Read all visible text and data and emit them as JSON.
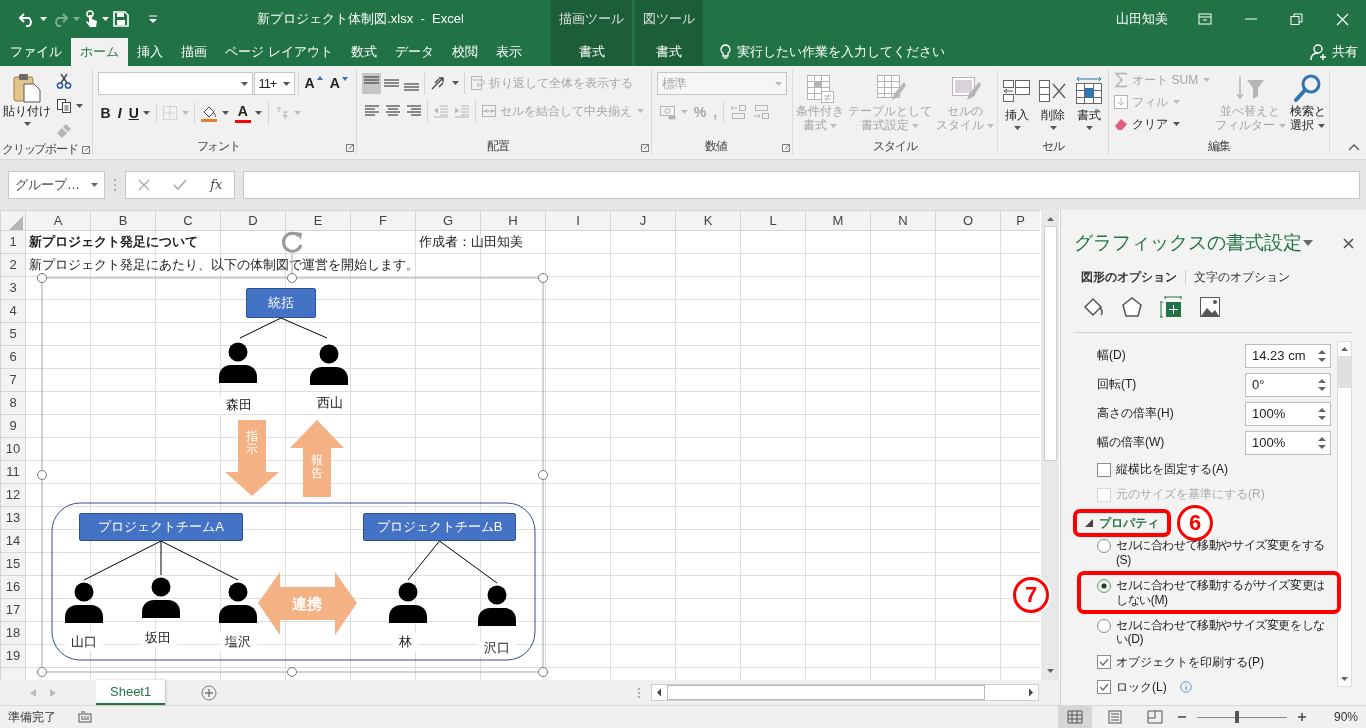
{
  "title_bar": {
    "title": "新プロジェクト体制図.xlsx  -  Excel",
    "user": "山田知美"
  },
  "tabs": [
    {
      "label": "ファイル",
      "selected": false
    },
    {
      "label": "ホーム",
      "selected": true
    },
    {
      "label": "挿入",
      "selected": false
    },
    {
      "label": "描画",
      "selected": false
    },
    {
      "label": "ページ レイアウト",
      "selected": false
    },
    {
      "label": "数式",
      "selected": false
    },
    {
      "label": "データ",
      "selected": false
    },
    {
      "label": "校閲",
      "selected": false
    },
    {
      "label": "表示",
      "selected": false
    }
  ],
  "tool_groups": [
    {
      "label": "描画ツール",
      "tabs": [
        {
          "label": "書式",
          "selected": false
        }
      ]
    },
    {
      "label": "図ツール",
      "tabs": [
        {
          "label": "書式",
          "selected": false
        }
      ]
    }
  ],
  "tell_me": {
    "placeholder": "実行したい作業を入力してください"
  },
  "share": "共有",
  "ribbon": [
    {
      "label": "クリップボード",
      "launcher": true,
      "lines": [
        [
          {
            "kind": "paste",
            "label": [
              "貼り付け"
            ],
            "menu": true,
            "disabled": false
          }
        ],
        [
          {
            "kind": "cut",
            "menu": false,
            "disabled": false
          },
          {
            "kind": "copy",
            "menu": true,
            "disabled": false
          },
          {
            "kind": "brush",
            "menu": false,
            "disabled": true
          }
        ]
      ]
    },
    {
      "label": "フォント",
      "launcher": true,
      "lines": [
        [
          [
            {
              "kind": "font-name",
              "menu": true,
              "disabled": false
            },
            {
              "kind": "font-size",
              "value": "11+",
              "menu": true,
              "disabled": false
            }
          ],
          [
            {
              "kind": "grow",
              "label": "A",
              "menu": false,
              "disabled": false
            },
            {
              "kind": "shrink",
              "label": "A",
              "menu": false,
              "disabled": false
            }
          ]
        ],
        [
          [
            {
              "kind": "bold",
              "label": "B",
              "menu": false,
              "disabled": false
            },
            {
              "kind": "italic",
              "label": "I",
              "menu": false,
              "disabled": false
            },
            {
              "kind": "underline",
              "label": "U",
              "menu": true,
              "disabled": false
            }
          ],
          [
            {
              "kind": "border",
              "menu": true,
              "disabled": true
            }
          ],
          [
            {
              "kind": "fill",
              "menu": true,
              "disabled": false
            },
            {
              "kind": "fontcolor",
              "label": "A",
              "menu": true,
              "disabled": false
            }
          ],
          [
            {
              "kind": "phonetic",
              "menu": true,
              "disabled": true
            }
          ]
        ]
      ]
    },
    {
      "label": "配置",
      "launcher": true,
      "lines": [
        [
          [
            {
              "kind": "align-top",
              "selected": true,
              "menu": false,
              "disabled": false
            },
            {
              "kind": "align-middle",
              "selected": false,
              "menu": false,
              "disabled": false
            },
            {
              "kind": "align-bottom",
              "selected": false,
              "menu": false,
              "disabled": false
            }
          ],
          [
            {
              "kind": "orient",
              "menu": true,
              "disabled": false
            }
          ],
          [
            {
              "kind": "wrap",
              "label": "折り返して全体を表示する",
              "menu": false,
              "disabled": true
            }
          ]
        ],
        [
          [
            {
              "kind": "align-left",
              "selected": false,
              "menu": false,
              "disabled": false
            },
            {
              "kind": "align-center",
              "selected": false,
              "menu": false,
              "disabled": false
            },
            {
              "kind": "align-right",
              "selected": false,
              "menu": false,
              "disabled": false
            }
          ],
          [
            {
              "kind": "indent-dec",
              "menu": false,
              "disabled": true
            },
            {
              "kind": "indent-inc",
              "menu": false,
              "disabled": true
            }
          ],
          [
            {
              "kind": "merge",
              "label": "セルを結合して中央揃え",
              "menu": true,
              "disabled": true
            }
          ]
        ]
      ]
    },
    {
      "label": "数値",
      "launcher": true,
      "lines": [
        [
          [
            {
              "kind": "number-format",
              "value": "標準",
              "menu": true,
              "disabled": true
            }
          ]
        ],
        [
          [
            {
              "kind": "currency",
              "menu": true,
              "disabled": true
            },
            {
              "kind": "percent",
              "label": "%",
              "menu": false,
              "disabled": true
            },
            {
              "kind": "comma",
              "label": ",",
              "menu": false,
              "disabled": true
            }
          ],
          [
            {
              "kind": "dec-inc",
              "menu": false,
              "disabled": true
            },
            {
              "kind": "dec-dec",
              "menu": false,
              "disabled": true
            }
          ]
        ]
      ]
    },
    {
      "label": "スタイル",
      "launcher": false,
      "lines": [
        [
          {
            "kind": "cond",
            "label": [
              "条件付き",
              "書式"
            ],
            "menu": true,
            "disabled": true
          }
        ],
        [
          {
            "kind": "table",
            "label": [
              "テーブルとして",
              "書式設定"
            ],
            "menu": true,
            "disabled": true
          }
        ],
        [
          {
            "kind": "cellstyle",
            "label": [
              "セルの",
              "スタイル"
            ],
            "menu": true,
            "disabled": true
          }
        ]
      ]
    },
    {
      "label": "セル",
      "launcher": false,
      "lines": [
        [
          {
            "kind": "insert",
            "label": [
              "挿入"
            ],
            "menu": true,
            "disabled": false
          }
        ],
        [
          {
            "kind": "delete",
            "label": [
              "削除"
            ],
            "menu": true,
            "disabled": false
          }
        ],
        [
          {
            "kind": "format",
            "label": [
              "書式"
            ],
            "menu": true,
            "disabled": false
          }
        ]
      ]
    },
    {
      "label": "編集",
      "launcher": false,
      "lines": [
        [
          {
            "kind": "sum",
            "label": "オート SUM",
            "menu": true,
            "disabled": true
          },
          {
            "kind": "filldown",
            "label": "フィル",
            "menu": true,
            "disabled": true
          },
          {
            "kind": "clear",
            "label": "クリア",
            "menu": true,
            "disabled": false
          }
        ],
        [
          {
            "kind": "sort",
            "label": [
              "並べ替えと",
              "フィルター"
            ],
            "menu": true,
            "disabled": true
          }
        ],
        [
          {
            "kind": "find",
            "label": [
              "検索と",
              "選択"
            ],
            "menu": true,
            "disabled": false
          }
        ]
      ]
    }
  ],
  "formula_bar": {
    "name_box": "グループ…",
    "function_label": "fx"
  },
  "sheet": {
    "columns": [
      "A",
      "B",
      "C",
      "D",
      "E",
      "F",
      "G",
      "H",
      "I",
      "J",
      "K",
      "L",
      "M",
      "N",
      "O",
      "P"
    ],
    "rows": [
      {
        "number": "1",
        "A": {
          "text": "新プロジェクト発足について",
          "bold": true
        },
        "G": {
          "text": "作成者：山田知美",
          "bold": false
        }
      },
      {
        "number": "2",
        "A": {
          "text": "新プロジェクト発足にあたり、以下の体制図で運営を開始します。",
          "bold": false
        }
      },
      {
        "number": "3"
      },
      {
        "number": "4"
      },
      {
        "number": "5"
      },
      {
        "number": "6"
      },
      {
        "number": "7"
      },
      {
        "number": "8"
      },
      {
        "number": "9"
      },
      {
        "number": "10"
      },
      {
        "number": "11"
      },
      {
        "number": "12"
      },
      {
        "number": "13"
      },
      {
        "number": "14"
      },
      {
        "number": "15"
      },
      {
        "number": "16"
      },
      {
        "number": "17"
      },
      {
        "number": "18"
      },
      {
        "number": "19"
      }
    ]
  },
  "diagram": {
    "head": "統括",
    "leaders": [
      "森田",
      "西山"
    ],
    "arrows": [
      {
        "label": "指示",
        "kind": "down"
      },
      {
        "label": "報告",
        "kind": "up"
      }
    ],
    "teams": [
      {
        "title": "プロジェクトチームA",
        "members": [
          "山口",
          "坂田",
          "塩沢"
        ]
      },
      {
        "title": "プロジェクトチームB",
        "members": [
          "林",
          "沢口"
        ]
      }
    ],
    "link": "連携"
  },
  "sheet_tabs": [
    {
      "label": "Sheet1",
      "selected": true
    }
  ],
  "pane": {
    "title": "グラフィックスの書式設定",
    "tabs": [
      {
        "label": "図形のオプション",
        "selected": true
      },
      {
        "label": "文字のオプション",
        "selected": false
      }
    ],
    "icon_tabs": [
      {
        "kind": "fill",
        "selected": false
      },
      {
        "kind": "shape",
        "selected": false
      },
      {
        "kind": "size",
        "selected": true
      },
      {
        "kind": "picture",
        "selected": false
      }
    ],
    "fields": [
      {
        "label": "幅(D)",
        "value": "14.23 cm"
      },
      {
        "label": "回転(T)",
        "value": "0°"
      },
      {
        "label": "高さの倍率(H)",
        "value": "100%"
      },
      {
        "label": "幅の倍率(W)",
        "value": "100%"
      }
    ],
    "size_checks": [
      {
        "label": "縦横比を固定する(A)",
        "checked": false,
        "disabled": false
      },
      {
        "label": "元のサイズを基準にする(R)",
        "checked": false,
        "disabled": true
      }
    ],
    "section": {
      "label": "プロパティ",
      "expanded": true,
      "highlighted": true
    },
    "radios": [
      {
        "label": "セルに合わせて移動やサイズ変更をする(S)",
        "selected": false,
        "highlighted": false
      },
      {
        "label": "セルに合わせて移動するがサイズ変更はしない(M)",
        "selected": true,
        "highlighted": true
      },
      {
        "label": "セルに合わせて移動やサイズ変更をしない(D)",
        "selected": false,
        "highlighted": false
      }
    ],
    "checks": [
      {
        "label": "オブジェクトを印刷する(P)",
        "checked": true,
        "info": false
      },
      {
        "label": "ロック(L)",
        "checked": true,
        "info": true
      }
    ]
  },
  "annotations": [
    {
      "number": "6"
    },
    {
      "number": "7"
    }
  ],
  "status_bar": {
    "text": "準備完了",
    "views": [
      {
        "kind": "normal",
        "selected": true
      },
      {
        "kind": "page-layout",
        "selected": false
      },
      {
        "kind": "page-break",
        "selected": false
      }
    ],
    "zoom": {
      "level": 0.45,
      "reading": "90%"
    }
  }
}
